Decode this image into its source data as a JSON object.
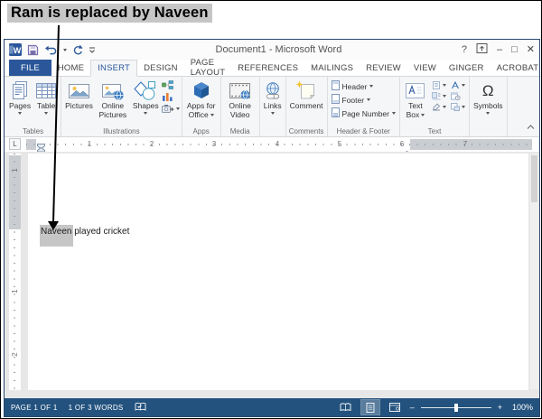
{
  "callout": {
    "text": "Ram is replaced by Naveen"
  },
  "titlebar": {
    "app_icon_letter": "W",
    "title": "Document1 - Microsoft Word",
    "help": "?",
    "minimize": "–",
    "maximize": "□",
    "close": "✕"
  },
  "tabs": {
    "file": "FILE",
    "home": "HOME",
    "insert": "INSERT",
    "design": "DESIGN",
    "page_layout": "PAGE LAYOUT",
    "references": "REFERENCES",
    "mailings": "MAILINGS",
    "review": "REVIEW",
    "view": "VIEW",
    "ginger": "GINGER",
    "acrobat": "ACROBAT"
  },
  "ribbon": {
    "pages": "Pages",
    "table": "Table",
    "tables_group": "Tables",
    "pictures": "Pictures",
    "online_pictures": "Online Pictures",
    "shapes": "Shapes",
    "illustrations_group": "Illustrations",
    "apps_for_office": "Apps for Office",
    "apps_group": "Apps",
    "online_video": "Online Video",
    "media_group": "Media",
    "links": "Links",
    "comment": "Comment",
    "comments_group": "Comments",
    "header": "Header",
    "footer": "Footer",
    "page_number": "Page Number",
    "header_footer_group": "Header & Footer",
    "text_box": "Text Box",
    "text_group": "Text",
    "omega": "Ω",
    "symbols": "Symbols"
  },
  "ruler": {
    "tab_selector": "L",
    "h_numbers": [
      "1",
      "2",
      "3",
      "4",
      "5",
      "6",
      "7"
    ],
    "v_numbers": [
      "1",
      "1",
      "2"
    ]
  },
  "document": {
    "highlight_word": "Naveen",
    "rest_text": " played cricket"
  },
  "statusbar": {
    "page_info": "PAGE 1 OF 1",
    "word_count": "1 OF 3 WORDS",
    "zoom_out": "–",
    "zoom_in": "+",
    "zoom_level": "100%"
  },
  "colors": {
    "accent_blue": "#2b579a",
    "status_bar": "#23527e",
    "highlight_gray": "#c6c6c6",
    "ribbon_bg": "#f5f6f8"
  }
}
